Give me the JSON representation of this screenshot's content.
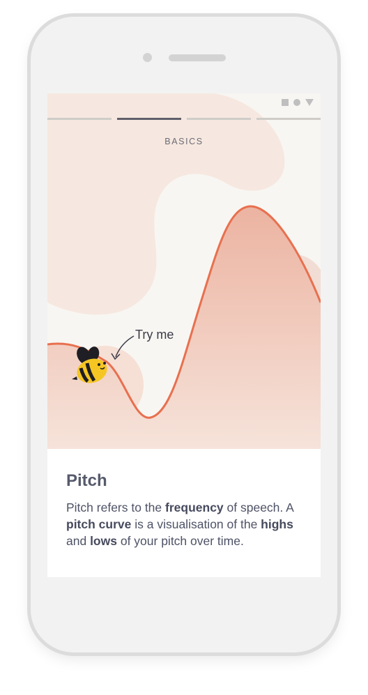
{
  "lesson": {
    "section": "BASICS",
    "progress": {
      "total_steps": 4,
      "current_step": 2
    }
  },
  "illustration": {
    "hint": "Try me",
    "character": "bee-icon",
    "curve_color": "#e8704f"
  },
  "card": {
    "title": "Pitch",
    "body": {
      "t1": "Pitch refers to the ",
      "b1": "frequency",
      "t2": " of speech. A ",
      "b2": "pitch curve",
      "t3": " is a visualisation of the ",
      "b3": "highs",
      "t4": " and ",
      "b4": "lows",
      "t5": " of your pitch over time."
    }
  },
  "status_bar": {
    "icons": [
      "square-icon",
      "circle-icon",
      "triangle-icon"
    ]
  }
}
